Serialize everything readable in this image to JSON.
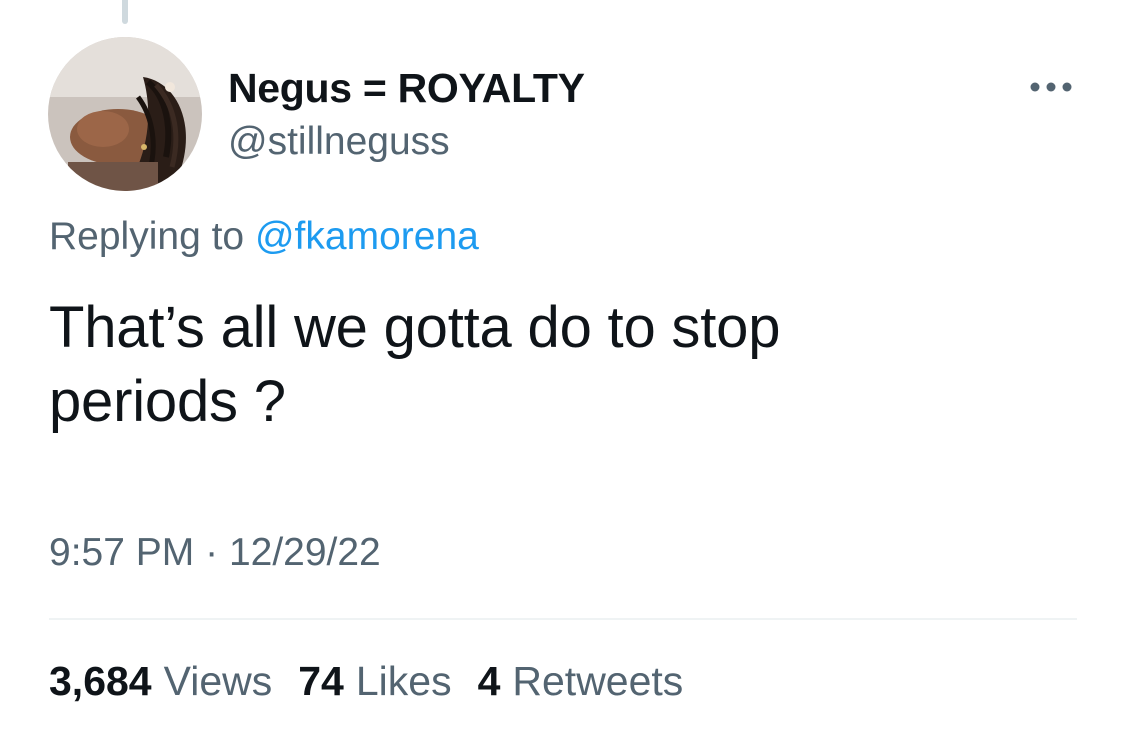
{
  "tweet": {
    "author": {
      "display_name": "Negus = ROYALTY",
      "handle": "@stillneguss",
      "avatar_icon": "profile-photo"
    },
    "more_icon": "more-options-icon",
    "reply": {
      "prefix": "Replying to",
      "mention": "@fkamorena"
    },
    "text": "That’s all we gotta do to stop periods ?",
    "time": "9:57 PM",
    "separator": "·",
    "date": "12/29/22",
    "stats": {
      "views_count": "3,684",
      "views_label": "Views",
      "likes_count": "74",
      "likes_label": "Likes",
      "retweets_count": "4",
      "retweets_label": "Retweets"
    }
  },
  "colors": {
    "text_primary": "#0f1419",
    "text_secondary": "#536471",
    "link": "#1d9bf0",
    "divider": "#eff3f4"
  }
}
